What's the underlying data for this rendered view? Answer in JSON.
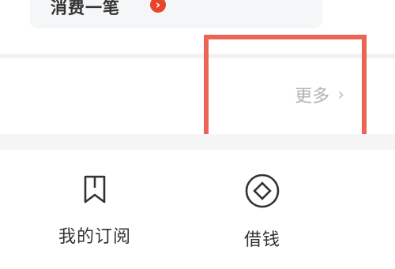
{
  "top_card": {
    "consume_text": "消费一笔",
    "arrow_icon": "chevron-right-icon"
  },
  "more_row": {
    "more_label": "更多",
    "chevron": "›"
  },
  "menu": {
    "items": [
      {
        "label": "我的订阅",
        "icon": "bookmark-icon"
      },
      {
        "label": "借钱",
        "icon": "coin-icon"
      }
    ]
  },
  "colors": {
    "accent": "#e8462c",
    "highlight_border": "#ea6554",
    "muted_text": "#b3b3b3",
    "primary_text": "#333333"
  }
}
